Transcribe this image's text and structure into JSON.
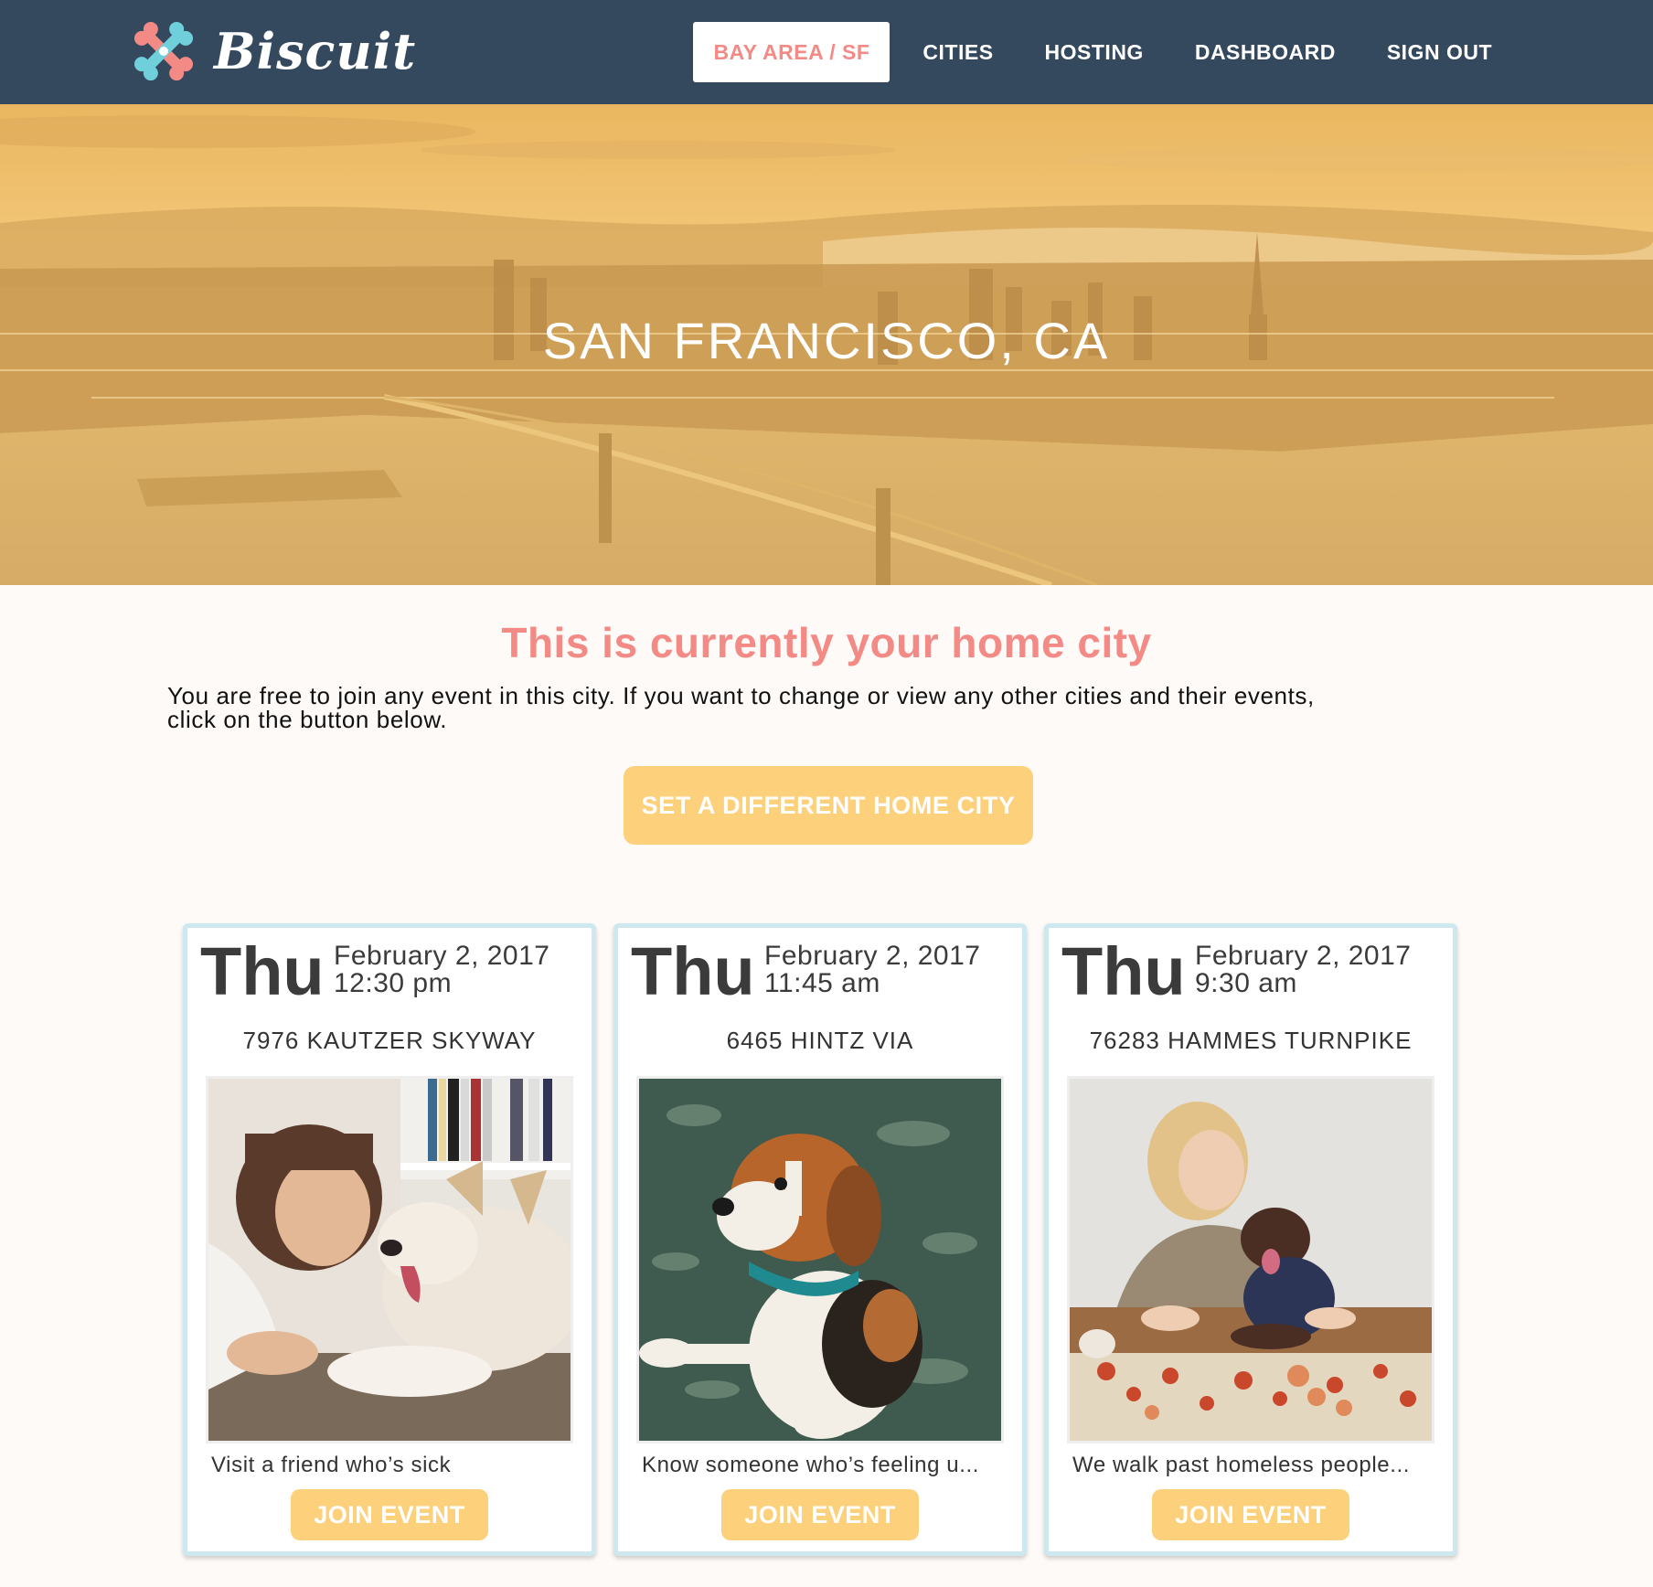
{
  "brand": {
    "name": "Biscuit",
    "logo_icon": "dog-bone-cross-logo"
  },
  "nav": {
    "items": [
      {
        "label": "BAY AREA / SF",
        "active": true
      },
      {
        "label": "CITIES",
        "active": false
      },
      {
        "label": "HOSTING",
        "active": false
      },
      {
        "label": "DASHBOARD",
        "active": false
      },
      {
        "label": "SIGN OUT",
        "active": false
      }
    ]
  },
  "hero": {
    "title": "SAN FRANCISCO, CA"
  },
  "home_city": {
    "heading": "This is currently your home city",
    "description_line1": "You are free to join any event in this city. If you want to change or view any other cities and their events,",
    "description_line2": "click on the button below.",
    "button_label": "SET A DIFFERENT HOME CITY"
  },
  "events": [
    {
      "day": "Thu",
      "date": "February 2, 2017",
      "time": "12:30 pm",
      "address": "7976 KAUTZER SKYWAY",
      "photo": "woman-with-husky-puppy-photo",
      "description": "Visit a friend who’s sick",
      "button_label": "JOIN EVENT"
    },
    {
      "day": "Thu",
      "date": "February 2, 2017",
      "time": "11:45 am",
      "address": "6465 HINTZ VIA",
      "photo": "beagle-sitting-photo",
      "description": "Know someone who’s feeling u...",
      "button_label": "JOIN EVENT"
    },
    {
      "day": "Thu",
      "date": "February 2, 2017",
      "time": "9:30 am",
      "address": "76283 HAMMES TURNPIKE",
      "photo": "woman-with-chocolate-lab-photo",
      "description": "We walk past homeless people...",
      "button_label": "JOIN EVENT"
    }
  ],
  "colors": {
    "navbar": "#34495e",
    "accent_pink": "#f38a85",
    "accent_yellow": "#fdd17c",
    "card_border": "#cde8ee",
    "page_bg": "#fdfaf7"
  }
}
